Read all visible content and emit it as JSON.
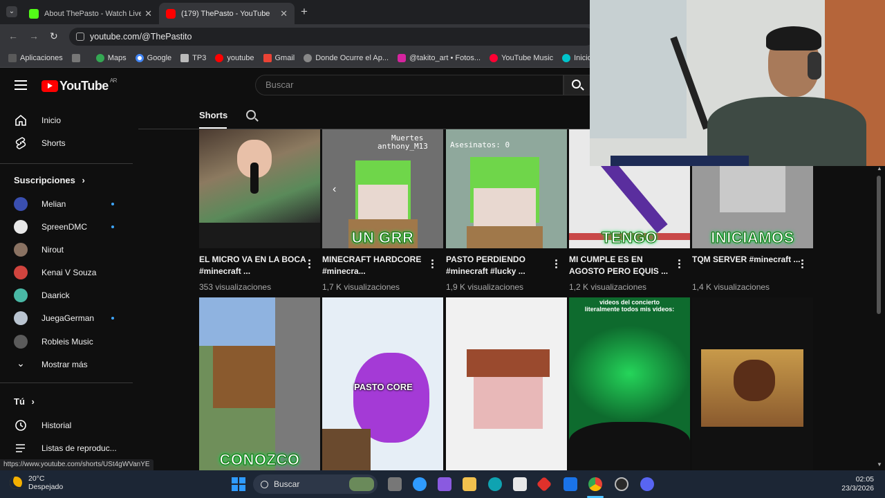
{
  "browser": {
    "tabs": [
      {
        "title": "About ThePasto - Watch Live on",
        "active": false
      },
      {
        "title": "(179) ThePasto - YouTube",
        "active": true
      }
    ],
    "new_tab": "+",
    "url": "youtube.com/@ThePastito",
    "status_url": "https://www.youtube.com/shorts/USt4gWVanYE",
    "bookmarks": [
      "Aplicaciones",
      "Maps",
      "Google",
      "TP3",
      "youtube",
      "Gmail",
      "Donde Ocurre el Ap...",
      "@takito_art • Fotos...",
      "YouTube Music",
      "Inicio - Can"
    ]
  },
  "youtube": {
    "logo_text": "YouTube",
    "country_code": "AR",
    "search_placeholder": "Buscar",
    "sidebar": {
      "home": "Inicio",
      "shorts": "Shorts",
      "subscriptions_header": "Suscripciones",
      "subscriptions": [
        {
          "name": "Melian",
          "new": true
        },
        {
          "name": "SpreenDMC",
          "new": true
        },
        {
          "name": "Nirout",
          "new": false
        },
        {
          "name": "Kenai V Souza",
          "new": false
        },
        {
          "name": "Daarick",
          "new": false
        },
        {
          "name": "JuegaGerman",
          "new": true
        },
        {
          "name": "Robleis Music",
          "new": false
        }
      ],
      "show_more": "Mostrar más",
      "you_header": "Tú",
      "history": "Historial",
      "playlists": "Listas de reproduc..."
    },
    "channel_tab": "Shorts",
    "shorts": [
      {
        "title": "EL MICRO VA EN LA BOCA #minecraft ...",
        "views": "353 visualizaciones",
        "caption": ""
      },
      {
        "title": "MINECRAFT HARDCORE #minecra...",
        "views": "1,7 K visualizaciones",
        "caption": "UN GRR"
      },
      {
        "title": "PASTO PERDIENDO #minecraft #lucky ...",
        "views": "1,9 K visualizaciones",
        "caption": ""
      },
      {
        "title": "MI CUMPLE ES EN AGOSTO PERO EQUIS ...",
        "views": "1,2 K visualizaciones",
        "caption": "TENGO"
      },
      {
        "title": "TQM SERVER #minecraft ...",
        "views": "1,4 K visualizaciones",
        "caption": "INICIAMOS"
      },
      {
        "title": "",
        "views": "",
        "caption": "CONOZCO"
      },
      {
        "title": "",
        "views": "",
        "caption": "PASTO CORE"
      },
      {
        "title": "",
        "views": "",
        "caption": ""
      },
      {
        "title": "",
        "views": "",
        "caption": "videos del concierto literalmente todos mis videos:"
      },
      {
        "title": "",
        "views": "",
        "caption": ""
      }
    ],
    "thumb_overlays": {
      "muertes": "Muertes",
      "player": "anthony_M13",
      "asesinatos": "Asesinatos: 0"
    }
  },
  "taskbar": {
    "temperature": "20°C",
    "weather": "Despejado",
    "search": "Buscar",
    "time": "02:05",
    "date": "23/3/2026"
  }
}
